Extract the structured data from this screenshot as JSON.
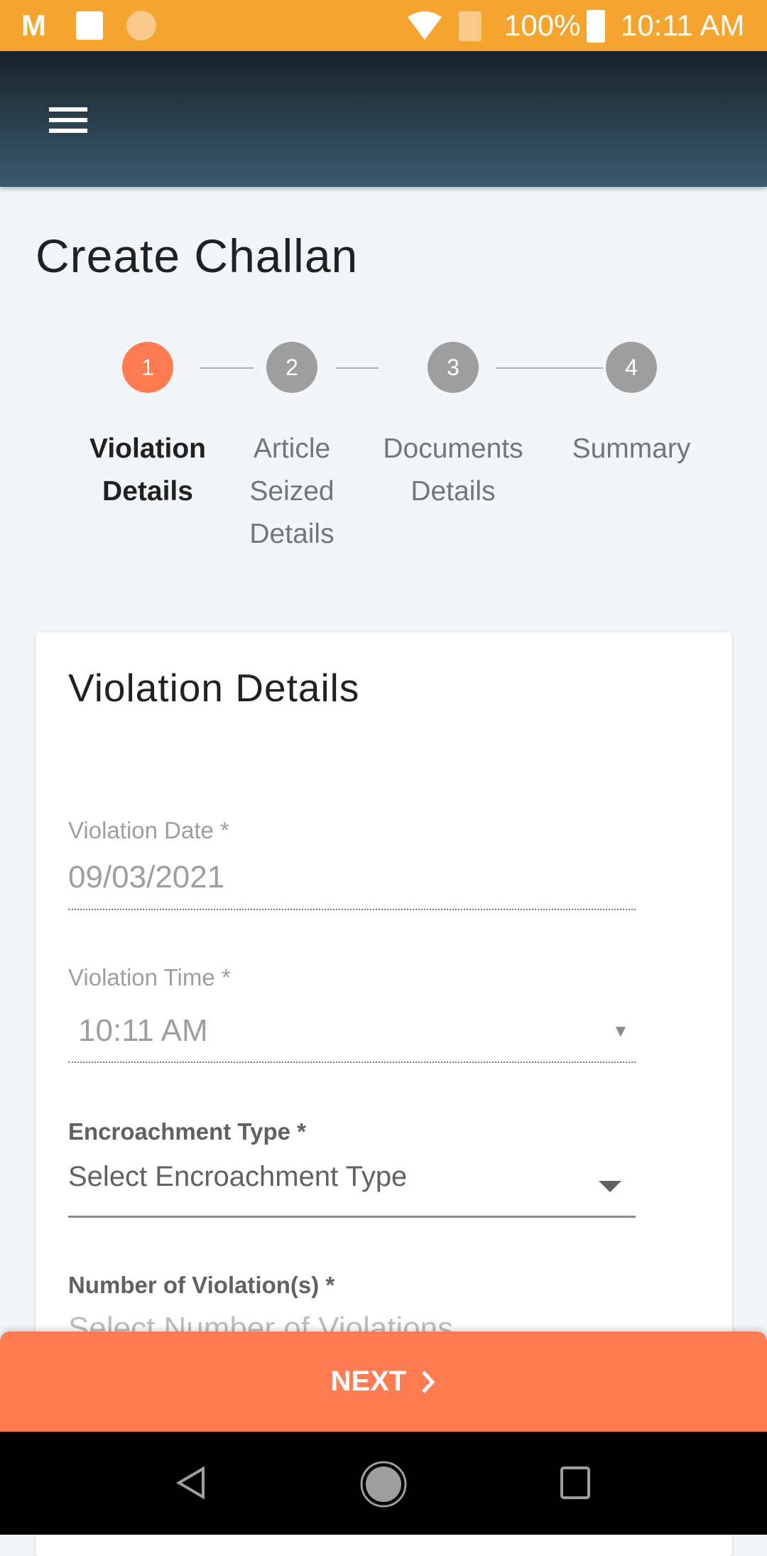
{
  "status_bar": {
    "battery": "100%",
    "time": "10:11 AM",
    "icons": [
      "gmail-icon",
      "gallery-icon",
      "app-icon",
      "wifi-icon",
      "no-sim-icon",
      "battery-charging-icon"
    ]
  },
  "app_bar": {
    "menu_icon": "hamburger-menu-icon"
  },
  "page": {
    "title": "Create Challan"
  },
  "stepper": {
    "steps": [
      {
        "number": "1",
        "label": "Violation Details",
        "active": true
      },
      {
        "number": "2",
        "label": "Article Seized Details",
        "active": false
      },
      {
        "number": "3",
        "label": "Documents Details",
        "active": false
      },
      {
        "number": "4",
        "label": "Summary",
        "active": false
      }
    ]
  },
  "form": {
    "title": "Violation Details",
    "date_label": "Violation Date *",
    "date_value": "09/03/2021",
    "time_label": "Violation Time *",
    "time_value": "10:11 AM",
    "encroachment_label": "Encroachment Type *",
    "encroachment_placeholder": "Select Encroachment Type",
    "violations_label": "Number of Violation(s) *",
    "violations_placeholder": "Select Number of Violations"
  },
  "next_button": {
    "label": "NEXT"
  },
  "colors": {
    "accent": "#ff7b52",
    "status_bar": "#f4a42f",
    "step_inactive": "#9e9e9e"
  }
}
